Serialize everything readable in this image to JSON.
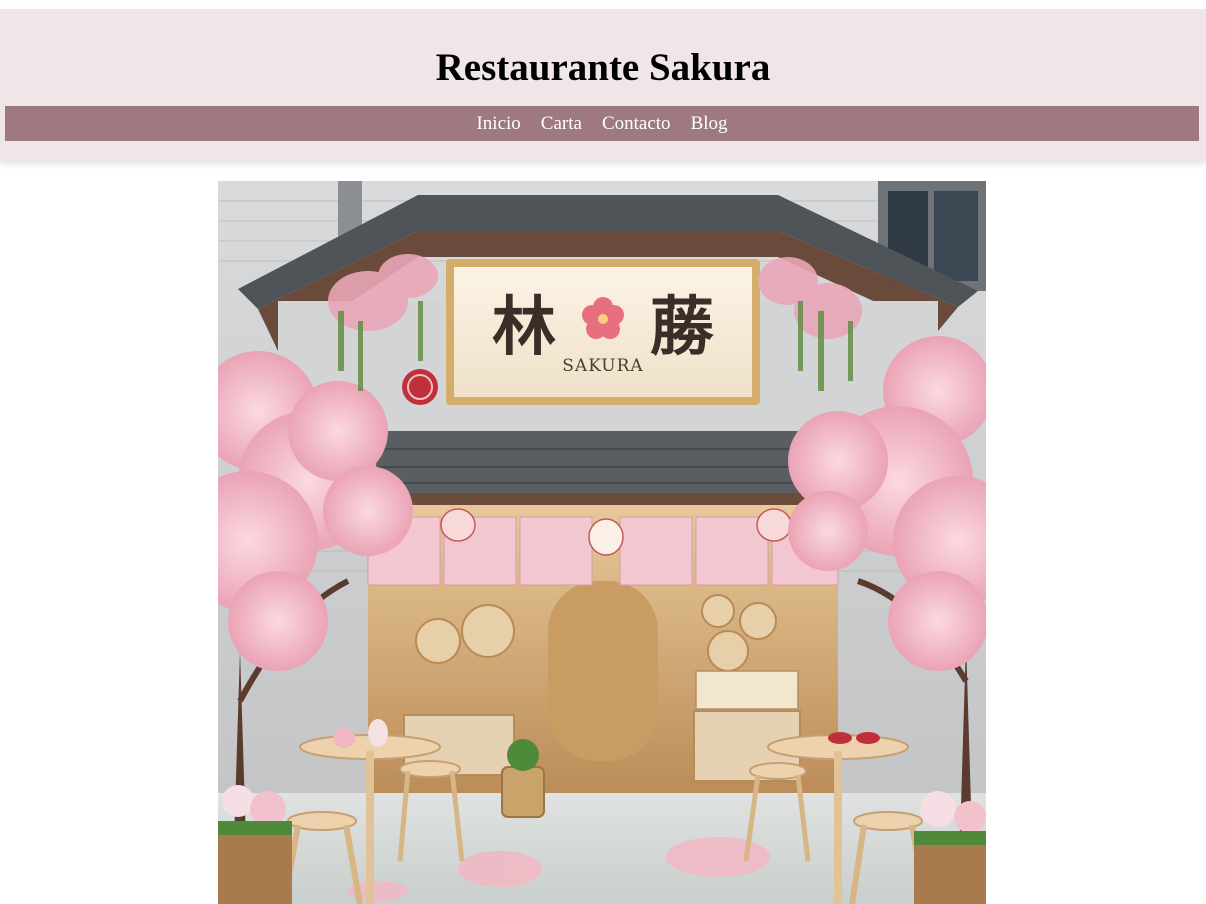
{
  "header": {
    "title": "Restaurante Sakura"
  },
  "nav": {
    "items": [
      {
        "label": "Inicio"
      },
      {
        "label": "Carta"
      },
      {
        "label": "Contacto"
      },
      {
        "label": "Blog"
      }
    ]
  },
  "hero": {
    "sign_text": "SAKURA",
    "colors": {
      "header_bg": "#f0e6e8",
      "nav_bg": "#9e7a80",
      "blossom": "#f2b8c6",
      "wall": "#cfd0d2",
      "roof": "#5b5f64"
    }
  }
}
